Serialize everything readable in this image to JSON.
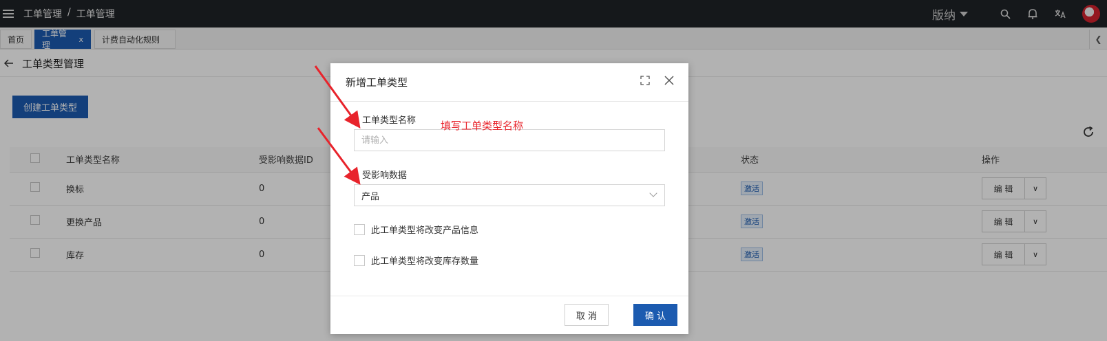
{
  "topbar": {
    "breadcrumb": [
      "工单管理",
      "/",
      "工单管理"
    ],
    "brand": "版纳",
    "icons": [
      "menu-icon",
      "search-icon",
      "bell-icon",
      "translate-icon",
      "avatar"
    ]
  },
  "tabs": [
    {
      "label": "首页"
    },
    {
      "label": "工单管理",
      "close": "x",
      "active": true
    },
    {
      "label": "计费自动化规则"
    }
  ],
  "page": {
    "title": "工单类型管理",
    "create_button": "创建工单类型"
  },
  "table": {
    "headers": [
      "工单类型名称",
      "受影响数据ID",
      "状态",
      "操作"
    ],
    "rows": [
      {
        "name": "换标",
        "data_id": "0",
        "status": "激活",
        "edit": "编 辑"
      },
      {
        "name": "更换产品",
        "data_id": "0",
        "status": "激活",
        "edit": "编 辑"
      },
      {
        "name": "库存",
        "data_id": "0",
        "status": "激活",
        "edit": "编 辑"
      }
    ]
  },
  "modal": {
    "title": "新增工单类型",
    "name_label": "工单类型名称",
    "name_placeholder": "请输入",
    "data_label": "受影响数据",
    "data_value": "产品",
    "checkbox_product": "此工单类型将改变产品信息",
    "checkbox_stock": "此工单类型将改变库存数量",
    "cancel": "取 消",
    "confirm": "确 认"
  },
  "annotation": {
    "text": "填写工单类型名称",
    "color": "#e8232b"
  },
  "colors": {
    "primary": "#1c5bb0",
    "topbar": "#1f2328"
  }
}
